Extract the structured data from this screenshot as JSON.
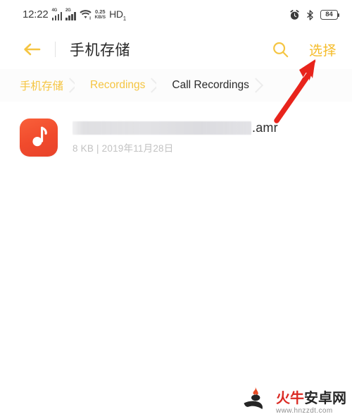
{
  "status_bar": {
    "clock": "12:22",
    "signal_1_label": "4G",
    "signal_2_label": "2G",
    "wifi_icon": "wifi-icon",
    "net_speed_value": "0.25",
    "net_speed_unit": "KB/S",
    "hd_label": "HD",
    "hd_sub": "1",
    "alarm_icon": "alarm-clock-icon",
    "bluetooth_icon": "bluetooth-icon",
    "battery_level": "84"
  },
  "header": {
    "back_icon": "back-arrow-icon",
    "title": "手机存储",
    "search_icon": "search-icon",
    "select_label": "选择"
  },
  "breadcrumb": {
    "items": [
      {
        "label": "手机存储",
        "state": "parent"
      },
      {
        "label": "Recordings",
        "state": "parent"
      },
      {
        "label": "Call Recordings",
        "state": "current"
      }
    ]
  },
  "file_list": {
    "rows": [
      {
        "icon": "music-note-icon",
        "name_redacted": true,
        "extension": ".amr",
        "size": "8 KB",
        "separator": "|",
        "date": "2019年11月28日",
        "subtitle": "8 KB | 2019年11月28日"
      }
    ]
  },
  "annotation": {
    "arrow_icon": "red-arrow-up-right-icon",
    "arrow_color": "#e8241c"
  },
  "watermark": {
    "logo_icon": "flame-bull-logo-icon",
    "title_red": "火牛",
    "title_dark": "安卓网",
    "url": "www.hnzzdt.com"
  },
  "colors": {
    "accent": "#f5c542",
    "select_text": "#f5bc2a",
    "title_text": "#262626",
    "file_icon_bg": "#f04a2c",
    "arrow_red": "#e8241c",
    "background": "#ffffff"
  }
}
